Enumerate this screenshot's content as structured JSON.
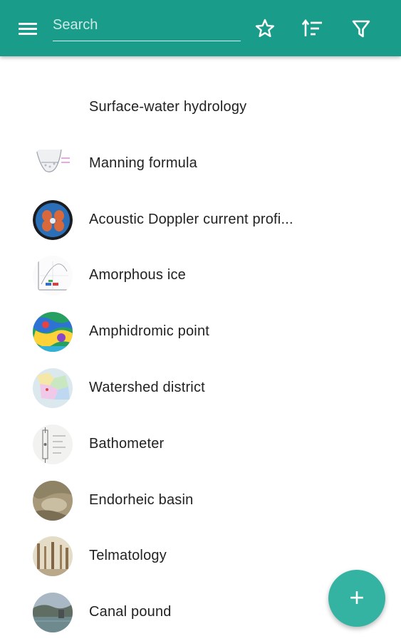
{
  "header": {
    "search_placeholder": "Search",
    "icons": [
      "menu-icon",
      "star-icon",
      "sort-icon",
      "filter-icon"
    ],
    "bar_color": "#199c8a"
  },
  "articles": [
    {
      "title": "Surface-water hydrology",
      "thumbnail": "none"
    },
    {
      "title": "Manning formula",
      "thumbnail": "channel-diagram"
    },
    {
      "title": "Acoustic Doppler current profi...",
      "thumbnail": "adcp-device"
    },
    {
      "title": "Amorphous ice",
      "thumbnail": "phase-diagram"
    },
    {
      "title": "Amphidromic point",
      "thumbnail": "tide-map"
    },
    {
      "title": "Watershed district",
      "thumbnail": "district-map"
    },
    {
      "title": "Bathometer",
      "thumbnail": "instrument-drawing"
    },
    {
      "title": "Endorheic basin",
      "thumbnail": "basin-photo"
    },
    {
      "title": "Telmatology",
      "thumbnail": "wetland-photo"
    },
    {
      "title": "Canal pound",
      "thumbnail": "canal-photo"
    }
  ],
  "fab": {
    "label": "+",
    "color": "#34b3a2"
  }
}
